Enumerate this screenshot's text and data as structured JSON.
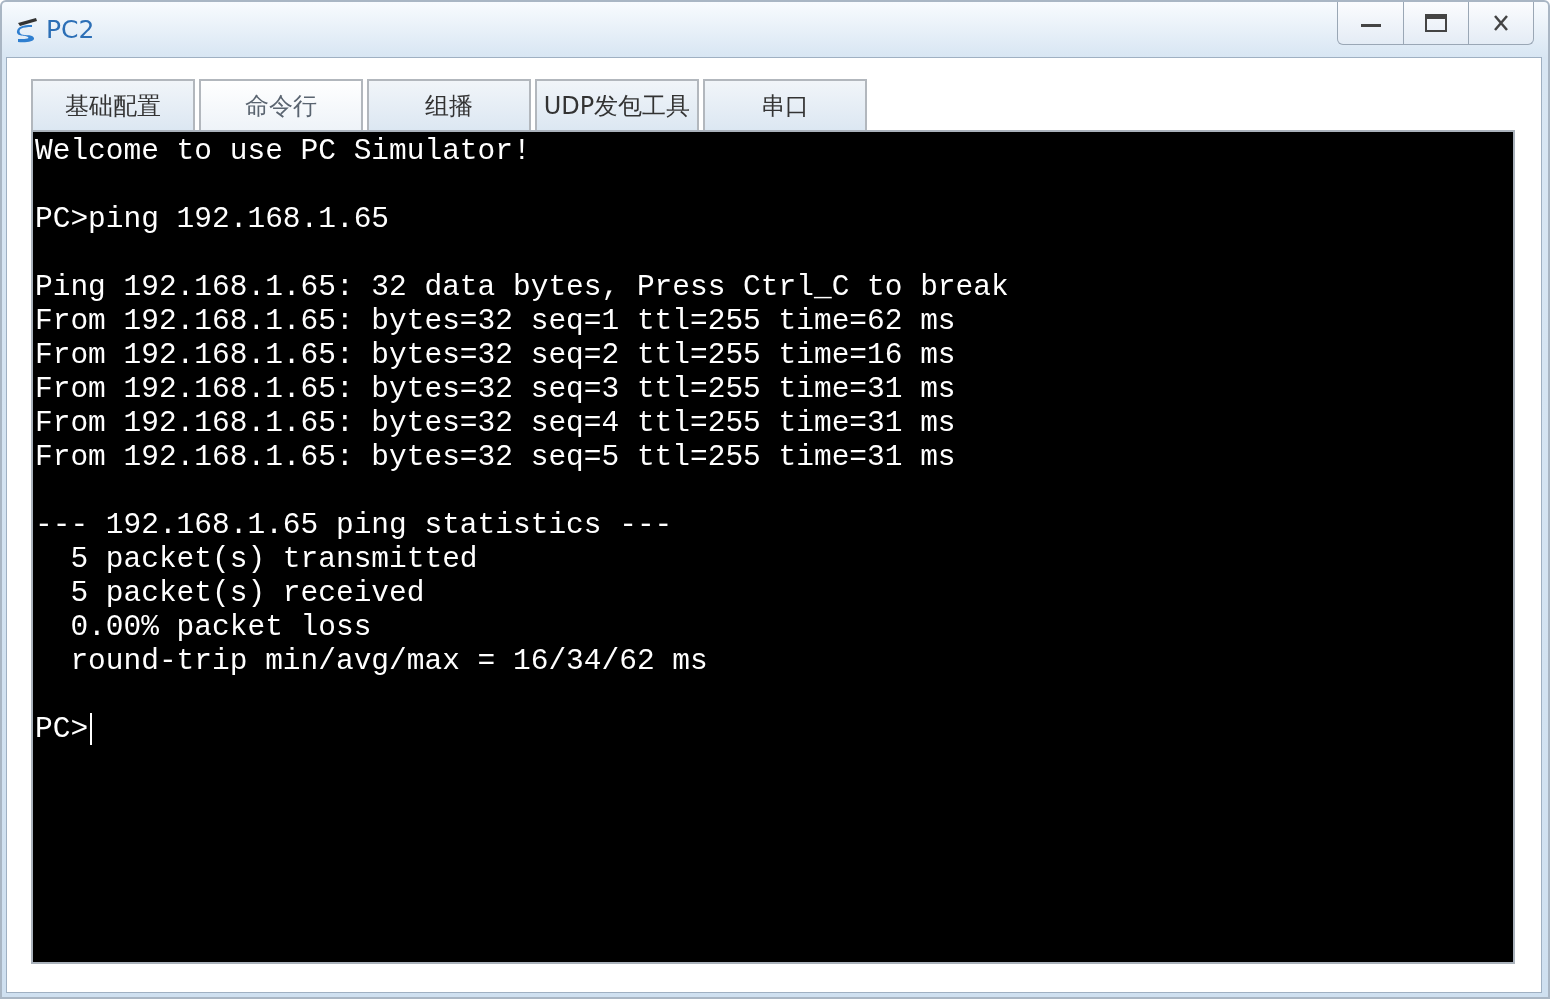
{
  "window": {
    "title": "PC2"
  },
  "tabs": [
    {
      "label": "基础配置",
      "selected": false
    },
    {
      "label": "命令行",
      "selected": true
    },
    {
      "label": "组播",
      "selected": false
    },
    {
      "label": "UDP发包工具",
      "selected": false
    },
    {
      "label": "串口",
      "selected": false
    }
  ],
  "terminal": {
    "blocks": [
      [
        "Welcome to use PC Simulator!"
      ],
      [
        "PC>ping 192.168.1.65"
      ],
      [
        "Ping 192.168.1.65: 32 data bytes, Press Ctrl_C to break",
        "From 192.168.1.65: bytes=32 seq=1 ttl=255 time=62 ms",
        "From 192.168.1.65: bytes=32 seq=2 ttl=255 time=16 ms",
        "From 192.168.1.65: bytes=32 seq=3 ttl=255 time=31 ms",
        "From 192.168.1.65: bytes=32 seq=4 ttl=255 time=31 ms",
        "From 192.168.1.65: bytes=32 seq=5 ttl=255 time=31 ms"
      ],
      [
        "--- 192.168.1.65 ping statistics ---",
        "  5 packet(s) transmitted",
        "  5 packet(s) received",
        "  0.00% packet loss",
        "  round-trip min/avg/max = 16/34/62 ms"
      ]
    ],
    "prompt": "PC>"
  }
}
